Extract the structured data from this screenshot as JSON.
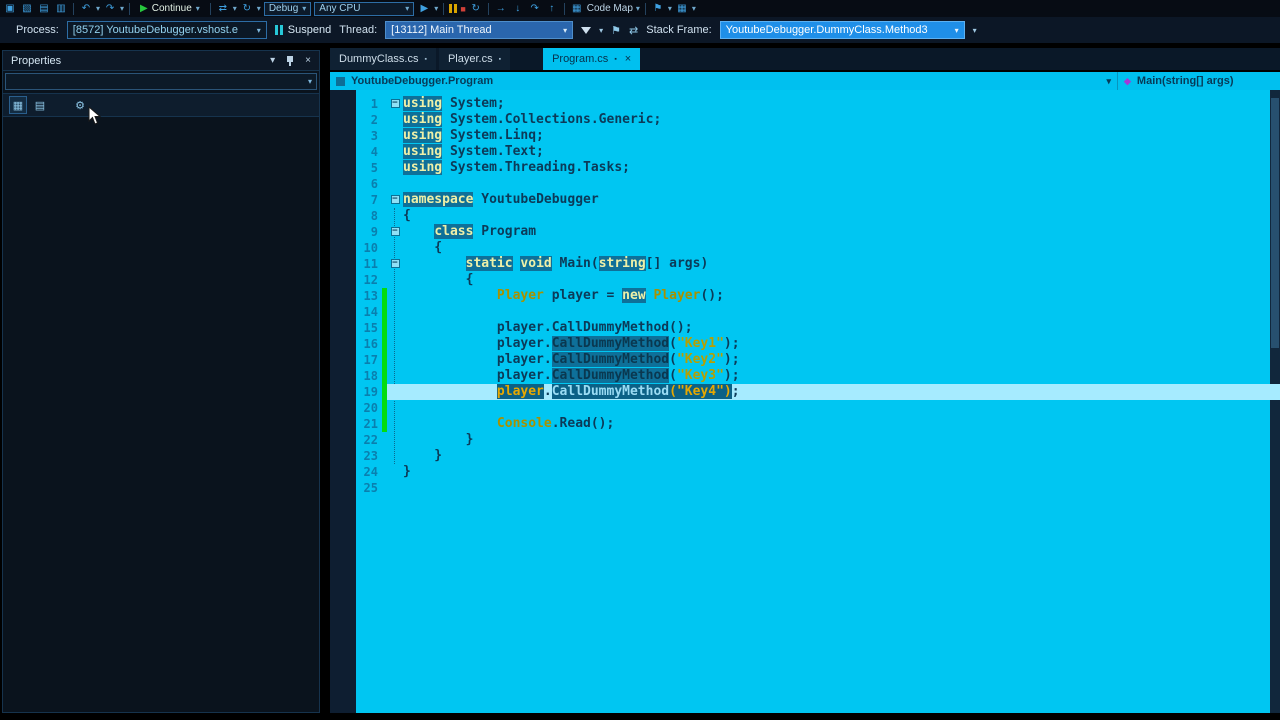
{
  "icons": {
    "dropdown": "▾",
    "app": "▣",
    "new": "▧",
    "save": "▤",
    "save_all": "▥",
    "undo": "↶",
    "redo": "↷",
    "play": "▶",
    "stop": "■",
    "restart": "↻",
    "show_next": "→",
    "step_into": "↓",
    "step_over": "↷",
    "step_out": "↑",
    "swap": "⇄",
    "flag": "⚑",
    "grid": "▦",
    "close": "×",
    "pin": "▪",
    "categorized": "▦",
    "alphabetical": "▤",
    "prop_pages": "⚙",
    "method": "◆"
  },
  "toolbar1": {
    "continue_label": "Continue",
    "debug_value": "Debug",
    "cpu_value": "Any CPU",
    "codemap_label": "Code Map"
  },
  "toolbar2": {
    "process_label": "Process:",
    "process_value": "[8572] YoutubeDebugger.vshost.e",
    "suspend_label": "Suspend",
    "thread_label": "Thread:",
    "thread_value": "[13112] Main Thread",
    "stackframe_label": "Stack Frame:",
    "stackframe_value": "YoutubeDebugger.DummyClass.Method3"
  },
  "properties": {
    "title": "Properties"
  },
  "tabs": [
    {
      "label": "DummyClass.cs"
    },
    {
      "label": "Player.cs"
    },
    {
      "label": "Program.cs"
    }
  ],
  "breadcrumb": {
    "scope": "YoutubeDebugger.Program",
    "member": "Main(string[] args)"
  },
  "editor": {
    "lines": [
      {
        "n": 1,
        "fold": true,
        "tokens": [
          {
            "t": "kw",
            "v": "using"
          },
          {
            "t": "plain",
            "v": " System;"
          }
        ]
      },
      {
        "n": 2,
        "tokens": [
          {
            "t": "kw",
            "v": "using"
          },
          {
            "t": "plain",
            "v": " System.Collections.Generic;"
          }
        ]
      },
      {
        "n": 3,
        "tokens": [
          {
            "t": "kw",
            "v": "using"
          },
          {
            "t": "plain",
            "v": " System.Linq;"
          }
        ]
      },
      {
        "n": 4,
        "tokens": [
          {
            "t": "kw",
            "v": "using"
          },
          {
            "t": "plain",
            "v": " System.Text;"
          }
        ]
      },
      {
        "n": 5,
        "tokens": [
          {
            "t": "kw",
            "v": "using"
          },
          {
            "t": "plain",
            "v": " System.Threading.Tasks;"
          }
        ]
      },
      {
        "n": 6,
        "tokens": []
      },
      {
        "n": 7,
        "fold": true,
        "tokens": [
          {
            "t": "kw",
            "v": "namespace"
          },
          {
            "t": "plain",
            "v": " YoutubeDebugger"
          }
        ]
      },
      {
        "n": 8,
        "tokens": [
          {
            "t": "plain",
            "v": "{"
          }
        ]
      },
      {
        "n": 9,
        "fold": true,
        "tokens": [
          {
            "t": "plain",
            "v": "    "
          },
          {
            "t": "kw",
            "v": "class"
          },
          {
            "t": "plain",
            "v": " Program"
          }
        ]
      },
      {
        "n": 10,
        "tokens": [
          {
            "t": "plain",
            "v": "    {"
          }
        ]
      },
      {
        "n": 11,
        "fold": true,
        "tokens": [
          {
            "t": "plain",
            "v": "        "
          },
          {
            "t": "kw",
            "v": "static"
          },
          {
            "t": "plain",
            "v": " "
          },
          {
            "t": "kw",
            "v": "void"
          },
          {
            "t": "plain",
            "v": " Main("
          },
          {
            "t": "kw",
            "v": "string"
          },
          {
            "t": "plain",
            "v": "[] args)"
          }
        ]
      },
      {
        "n": 12,
        "tokens": [
          {
            "t": "plain",
            "v": "        {"
          }
        ]
      },
      {
        "n": 13,
        "changed": true,
        "tokens": [
          {
            "t": "plain",
            "v": "            "
          },
          {
            "t": "type",
            "v": "Player"
          },
          {
            "t": "plain",
            "v": " player = "
          },
          {
            "t": "kw",
            "v": "new"
          },
          {
            "t": "plain",
            "v": " "
          },
          {
            "t": "type",
            "v": "Player"
          },
          {
            "t": "plain",
            "v": "();"
          }
        ]
      },
      {
        "n": 14,
        "changed": true,
        "tokens": []
      },
      {
        "n": 15,
        "changed": true,
        "tokens": [
          {
            "t": "plain",
            "v": "            player.CallDummyMethod();"
          }
        ]
      },
      {
        "n": 16,
        "changed": true,
        "tokens": [
          {
            "t": "plain",
            "v": "            player."
          },
          {
            "t": "hl",
            "v": "CallDummyMethod"
          },
          {
            "t": "plain",
            "v": "("
          },
          {
            "t": "str",
            "v": "\"Key1\""
          },
          {
            "t": "plain",
            "v": ");"
          }
        ]
      },
      {
        "n": 17,
        "changed": true,
        "tokens": [
          {
            "t": "plain",
            "v": "            player."
          },
          {
            "t": "hl",
            "v": "CallDummyMethod"
          },
          {
            "t": "plain",
            "v": "("
          },
          {
            "t": "str",
            "v": "\"Key2\""
          },
          {
            "t": "plain",
            "v": ");"
          }
        ]
      },
      {
        "n": 18,
        "changed": true,
        "tokens": [
          {
            "t": "plain",
            "v": "            player."
          },
          {
            "t": "hl",
            "v": "CallDummyMethod"
          },
          {
            "t": "plain",
            "v": "("
          },
          {
            "t": "str",
            "v": "\"Key3\""
          },
          {
            "t": "plain",
            "v": ");"
          }
        ]
      },
      {
        "n": 19,
        "changed": true,
        "current": true,
        "tokens": [
          {
            "t": "plain",
            "v": "            "
          },
          {
            "t": "selo",
            "v": "player"
          },
          {
            "t": "plain",
            "v": "."
          },
          {
            "t": "selm",
            "v": "CallDummyMethod"
          },
          {
            "t": "selo",
            "v": "(\"Key4\")"
          },
          {
            "t": "plain",
            "v": ";"
          }
        ]
      },
      {
        "n": 20,
        "changed": true,
        "tokens": []
      },
      {
        "n": 21,
        "changed": true,
        "tokens": [
          {
            "t": "plain",
            "v": "            "
          },
          {
            "t": "type",
            "v": "Console"
          },
          {
            "t": "plain",
            "v": ".Read();"
          }
        ]
      },
      {
        "n": 22,
        "tokens": [
          {
            "t": "plain",
            "v": "        }"
          }
        ]
      },
      {
        "n": 23,
        "tokens": [
          {
            "t": "plain",
            "v": "    }"
          }
        ]
      },
      {
        "n": 24,
        "tokens": [
          {
            "t": "plain",
            "v": "}"
          }
        ]
      },
      {
        "n": 25,
        "tokens": []
      }
    ]
  }
}
